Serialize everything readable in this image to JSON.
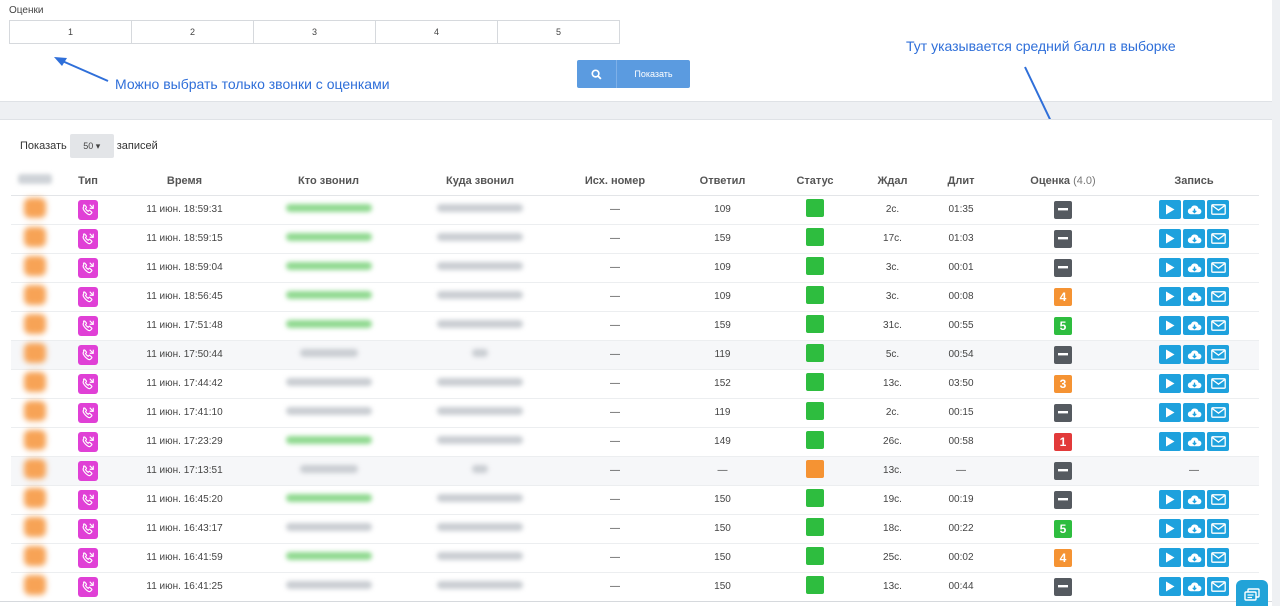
{
  "filter": {
    "rating_label": "Оценки",
    "rating_options": [
      "1",
      "2",
      "3",
      "4",
      "5"
    ],
    "search_label": "Показать"
  },
  "annotations": {
    "left_note": "Можно выбрать только звонки с оценками",
    "right_note": "Тут указывается средний балл в выборке"
  },
  "table_controls": {
    "show_prefix": "Показать",
    "page_size": "50",
    "show_suffix": "записей"
  },
  "columns": {
    "type": "Тип",
    "time": "Время",
    "caller": "Кто звонил",
    "callee": "Куда звонил",
    "outgoing": "Исх. номер",
    "answered": "Ответил",
    "status": "Статус",
    "waited": "Ждал",
    "duration": "Длит",
    "rating": "Оценка",
    "rating_avg": "(4.0)",
    "record": "Запись"
  },
  "colors": {
    "status_ok": "#2ebd3f",
    "status_missed": "#f59333",
    "rating_none": "#555a60",
    "rating_1": "#e23a3a",
    "rating_3": "#f59333",
    "rating_4": "#f59333",
    "rating_5": "#2ebd3f"
  },
  "rows": [
    {
      "time": "11 июн. 18:59:31",
      "outgoing": "—",
      "answered": "109",
      "status": "ok",
      "waited": "2с.",
      "duration": "01:35",
      "rating": "",
      "has_record": true,
      "caller_style": "green",
      "callee_style": "grey"
    },
    {
      "time": "11 июн. 18:59:15",
      "outgoing": "—",
      "answered": "159",
      "status": "ok",
      "waited": "17с.",
      "duration": "01:03",
      "rating": "",
      "has_record": true,
      "caller_style": "green",
      "callee_style": "grey"
    },
    {
      "time": "11 июн. 18:59:04",
      "outgoing": "—",
      "answered": "109",
      "status": "ok",
      "waited": "3с.",
      "duration": "00:01",
      "rating": "",
      "has_record": true,
      "caller_style": "green",
      "callee_style": "grey"
    },
    {
      "time": "11 июн. 18:56:45",
      "outgoing": "—",
      "answered": "109",
      "status": "ok",
      "waited": "3с.",
      "duration": "00:08",
      "rating": "4",
      "has_record": true,
      "caller_style": "green",
      "callee_style": "grey"
    },
    {
      "time": "11 июн. 17:51:48",
      "outgoing": "—",
      "answered": "159",
      "status": "ok",
      "waited": "31с.",
      "duration": "00:55",
      "rating": "5",
      "has_record": true,
      "caller_style": "green",
      "callee_style": "grey"
    },
    {
      "time": "11 июн. 17:50:44",
      "outgoing": "—",
      "answered": "119",
      "status": "ok",
      "waited": "5с.",
      "duration": "00:54",
      "rating": "",
      "has_record": true,
      "caller_style": "grey-short",
      "callee_style": "grey-tiny"
    },
    {
      "time": "11 июн. 17:44:42",
      "outgoing": "—",
      "answered": "152",
      "status": "ok",
      "waited": "13с.",
      "duration": "03:50",
      "rating": "3",
      "has_record": true,
      "caller_style": "grey",
      "callee_style": "grey"
    },
    {
      "time": "11 июн. 17:41:10",
      "outgoing": "—",
      "answered": "119",
      "status": "ok",
      "waited": "2с.",
      "duration": "00:15",
      "rating": "",
      "has_record": true,
      "caller_style": "grey",
      "callee_style": "grey"
    },
    {
      "time": "11 июн. 17:23:29",
      "outgoing": "—",
      "answered": "149",
      "status": "ok",
      "waited": "26с.",
      "duration": "00:58",
      "rating": "1",
      "has_record": true,
      "caller_style": "green",
      "callee_style": "grey"
    },
    {
      "time": "11 июн. 17:13:51",
      "outgoing": "—",
      "answered": "—",
      "status": "missed",
      "waited": "13с.",
      "duration": "—",
      "rating": "",
      "has_record": false,
      "caller_style": "grey-short",
      "callee_style": "grey-tiny"
    },
    {
      "time": "11 июн. 16:45:20",
      "outgoing": "—",
      "answered": "150",
      "status": "ok",
      "waited": "19с.",
      "duration": "00:19",
      "rating": "",
      "has_record": true,
      "caller_style": "green",
      "callee_style": "grey"
    },
    {
      "time": "11 июн. 16:43:17",
      "outgoing": "—",
      "answered": "150",
      "status": "ok",
      "waited": "18с.",
      "duration": "00:22",
      "rating": "5",
      "has_record": true,
      "caller_style": "grey",
      "callee_style": "grey"
    },
    {
      "time": "11 июн. 16:41:59",
      "outgoing": "—",
      "answered": "150",
      "status": "ok",
      "waited": "25с.",
      "duration": "00:02",
      "rating": "4",
      "has_record": true,
      "caller_style": "green",
      "callee_style": "grey"
    },
    {
      "time": "11 июн. 16:41:25",
      "outgoing": "—",
      "answered": "150",
      "status": "ok",
      "waited": "13с.",
      "duration": "00:44",
      "rating": "",
      "has_record": true,
      "caller_style": "grey",
      "callee_style": "grey"
    }
  ],
  "no_record_text": "—"
}
